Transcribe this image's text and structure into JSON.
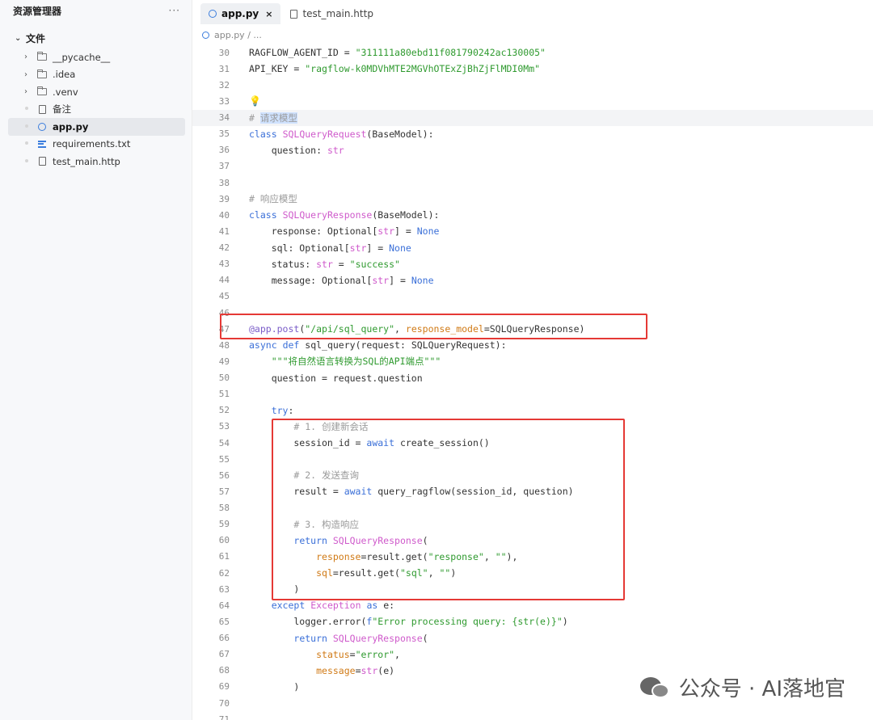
{
  "sidebar": {
    "title": "资源管理器",
    "more": "···",
    "section": "文件",
    "items": [
      {
        "label": "__pycache__",
        "kind": "folder",
        "icon": "folder-icon"
      },
      {
        "label": ".idea",
        "kind": "folder",
        "icon": "folder-icon"
      },
      {
        "label": ".venv",
        "kind": "folder",
        "icon": "folder-icon"
      },
      {
        "label": "备注",
        "kind": "file",
        "icon": "file-icon"
      },
      {
        "label": "app.py",
        "kind": "py",
        "icon": "python-file-icon",
        "active": true
      },
      {
        "label": "requirements.txt",
        "kind": "txt",
        "icon": "text-lines-icon"
      },
      {
        "label": "test_main.http",
        "kind": "file",
        "icon": "file-icon"
      }
    ]
  },
  "tabs": [
    {
      "label": "app.py",
      "close": "×",
      "active": true
    },
    {
      "label": "test_main.http",
      "active": false
    }
  ],
  "breadcrumb": "app.py / ...",
  "code": [
    {
      "n": "30",
      "t": "RAGFLOW_AGENT_ID = \"311111a80ebd11f081790242ac130005\""
    },
    {
      "n": "31",
      "t": "API_KEY = \"ragflow-k0MDVhMTE2MGVhOTExZjBhZjFlMDI0Mm\""
    },
    {
      "n": "32",
      "t": ""
    },
    {
      "n": "33",
      "t": ""
    },
    {
      "n": "34",
      "t": "# 请求模型"
    },
    {
      "n": "35",
      "t": "class SQLQueryRequest(BaseModel):"
    },
    {
      "n": "36",
      "t": "    question: str"
    },
    {
      "n": "37",
      "t": ""
    },
    {
      "n": "38",
      "t": ""
    },
    {
      "n": "39",
      "t": "# 响应模型"
    },
    {
      "n": "40",
      "t": "class SQLQueryResponse(BaseModel):"
    },
    {
      "n": "41",
      "t": "    response: Optional[str] = None"
    },
    {
      "n": "42",
      "t": "    sql: Optional[str] = None"
    },
    {
      "n": "43",
      "t": "    status: str = \"success\""
    },
    {
      "n": "44",
      "t": "    message: Optional[str] = None"
    },
    {
      "n": "45",
      "t": ""
    },
    {
      "n": "46",
      "t": ""
    },
    {
      "n": "47",
      "t": "@app.post(\"/api/sql_query\", response_model=SQLQueryResponse)"
    },
    {
      "n": "48",
      "t": "async def sql_query(request: SQLQueryRequest):"
    },
    {
      "n": "49",
      "t": "    \"\"\"将自然语言转换为SQL的API端点\"\"\""
    },
    {
      "n": "50",
      "t": "    question = request.question"
    },
    {
      "n": "51",
      "t": ""
    },
    {
      "n": "52",
      "t": "    try:"
    },
    {
      "n": "53",
      "t": "        # 1. 创建新会话"
    },
    {
      "n": "54",
      "t": "        session_id = await create_session()"
    },
    {
      "n": "55",
      "t": ""
    },
    {
      "n": "56",
      "t": "        # 2. 发送查询"
    },
    {
      "n": "57",
      "t": "        result = await query_ragflow(session_id, question)"
    },
    {
      "n": "58",
      "t": ""
    },
    {
      "n": "59",
      "t": "        # 3. 构造响应"
    },
    {
      "n": "60",
      "t": "        return SQLQueryResponse("
    },
    {
      "n": "61",
      "t": "            response=result.get(\"response\", \"\"),"
    },
    {
      "n": "62",
      "t": "            sql=result.get(\"sql\", \"\")"
    },
    {
      "n": "63",
      "t": "        )"
    },
    {
      "n": "64",
      "t": "    except Exception as e:"
    },
    {
      "n": "65",
      "t": "        logger.error(f\"Error processing query: {str(e)}\")"
    },
    {
      "n": "66",
      "t": "        return SQLQueryResponse("
    },
    {
      "n": "67",
      "t": "            status=\"error\","
    },
    {
      "n": "68",
      "t": "            message=str(e)"
    },
    {
      "n": "69",
      "t": "        )"
    },
    {
      "n": "70",
      "t": ""
    },
    {
      "n": "71",
      "t": ""
    }
  ],
  "watermark": "公众号 · AI落地官",
  "colors": {
    "keyword": "#3a6fd8",
    "class_name": "#cf5acb",
    "string": "#2f9a2f",
    "comment": "#9a9a9a",
    "highlight_box": "#e53935"
  }
}
